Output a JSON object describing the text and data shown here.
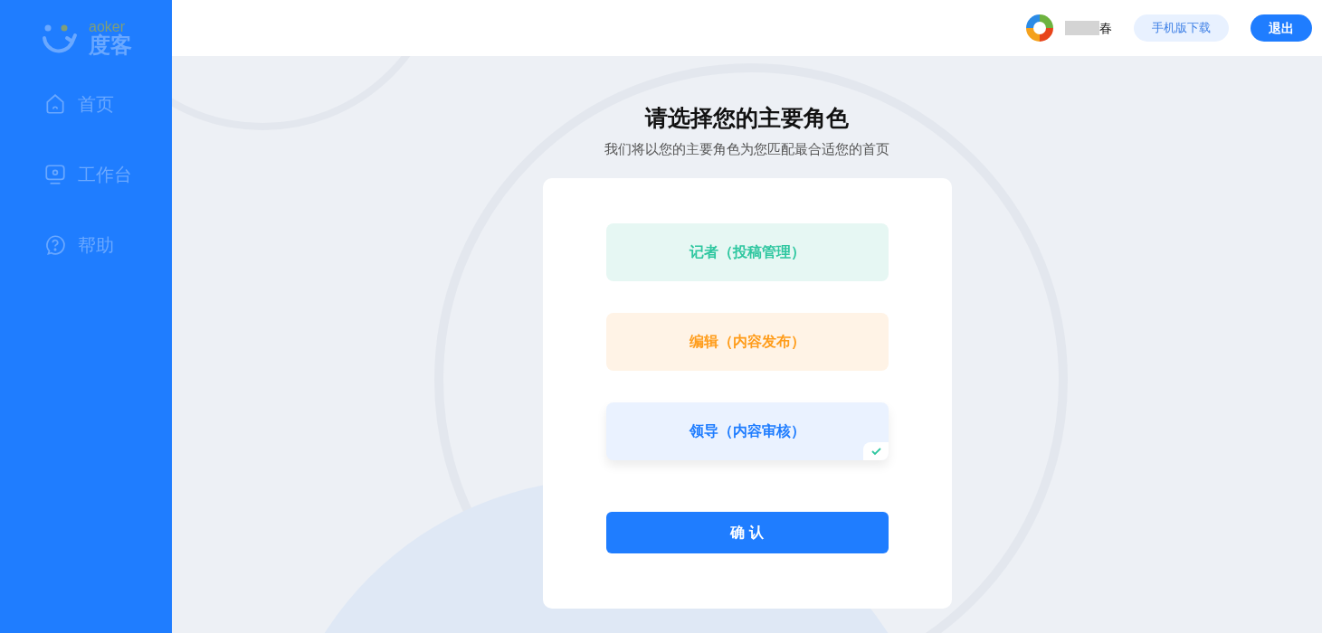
{
  "sidebar": {
    "logo": {
      "latin": "aoker",
      "name": "度客"
    },
    "items": [
      {
        "label": "首页",
        "kind": "home",
        "selected": false
      },
      {
        "label": "工作台",
        "kind": "desk",
        "selected": false
      },
      {
        "label": "帮助",
        "kind": "help",
        "selected": false
      }
    ]
  },
  "header": {
    "user_name": "春",
    "download_button": "手机版下载",
    "logout_button": "退出"
  },
  "title": "请选择您的主要角色",
  "subtitle": "我们将以您的主要角色为您匹配最合适您的首页",
  "roles": [
    {
      "label": "记者（投稿管理）",
      "color": "#2fc7a0",
      "selected": false
    },
    {
      "label": "编辑（内容发布）",
      "color": "#ff9c1a",
      "selected": false
    },
    {
      "label": "领导（内容审核）",
      "color": "#1f7dff",
      "selected": true
    }
  ],
  "confirm_button": "确 认"
}
